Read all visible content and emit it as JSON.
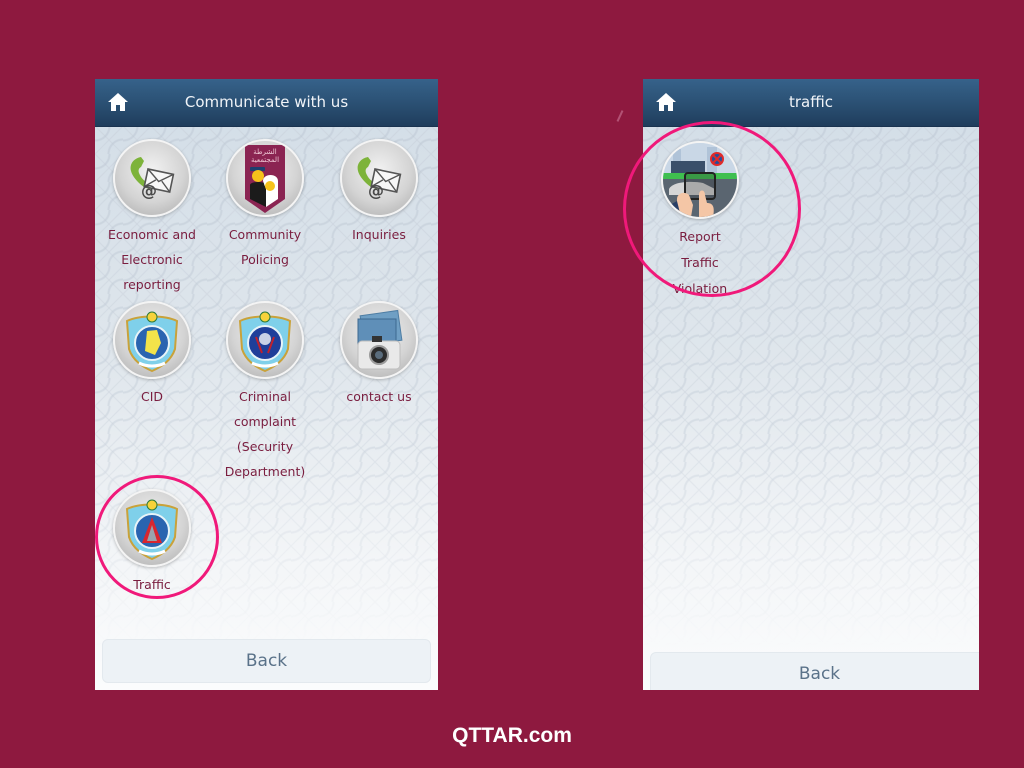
{
  "colors": {
    "background": "#8e193f",
    "header": "#2a4f72",
    "label_text": "#7a1d3f",
    "highlight_ring": "#f0197a",
    "back_text": "#5a7289"
  },
  "left_screen": {
    "header": {
      "home_icon": "home-icon",
      "title": "Communicate with us"
    },
    "items": [
      {
        "label": "Economic and Electronic reporting",
        "icon": "phone-mail-icon"
      },
      {
        "label": "Community Policing",
        "icon": "community-policing-badge-icon",
        "badge_text_line1": "الشرطة",
        "badge_text_line2": "المجتمعية"
      },
      {
        "label": "Inquiries",
        "icon": "phone-mail-icon"
      },
      {
        "label": "CID",
        "icon": "ministry-emblem-cid-icon"
      },
      {
        "label": "Criminal complaint (Security Department)",
        "icon": "ministry-emblem-security-icon"
      },
      {
        "label": "contact us",
        "icon": "camera-photos-icon"
      },
      {
        "label": "Traffic",
        "icon": "ministry-emblem-traffic-icon",
        "highlighted": true
      }
    ],
    "back_label": "Back"
  },
  "right_screen": {
    "header": {
      "home_icon": "home-icon",
      "title": "traffic"
    },
    "items": [
      {
        "label": "Report Traffic Violation",
        "icon": "report-violation-phone-icon",
        "highlighted": true
      }
    ],
    "back_label": "Back"
  },
  "watermark": "QTTAR.com"
}
